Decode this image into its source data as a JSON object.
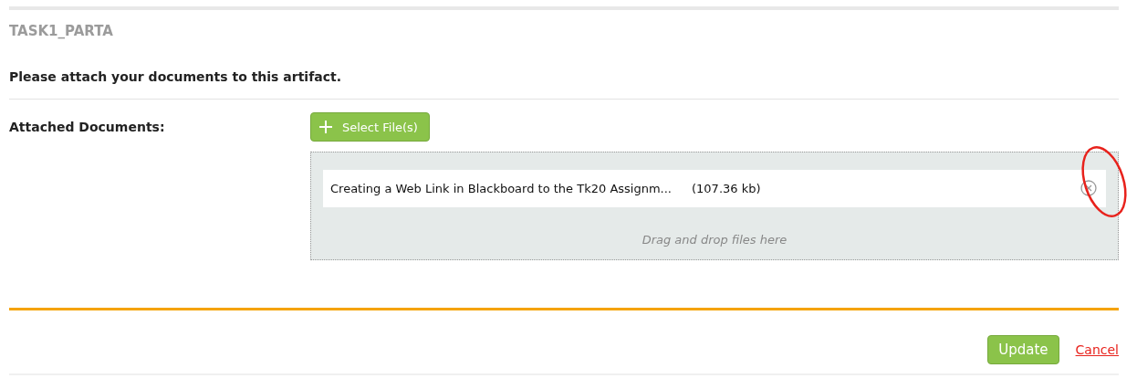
{
  "title": "TASK1_PARTA",
  "instruction": "Please attach your documents to this artifact.",
  "attachments": {
    "label": "Attached Documents:",
    "select_button": "Select File(s)",
    "files": [
      {
        "name": "Creating a Web Link in Blackboard to the Tk20 Assignm...",
        "size": "(107.36 kb)"
      }
    ],
    "dropzone_hint": "Drag and drop files here"
  },
  "footer": {
    "update_button": "Update",
    "cancel_link": "Cancel"
  }
}
